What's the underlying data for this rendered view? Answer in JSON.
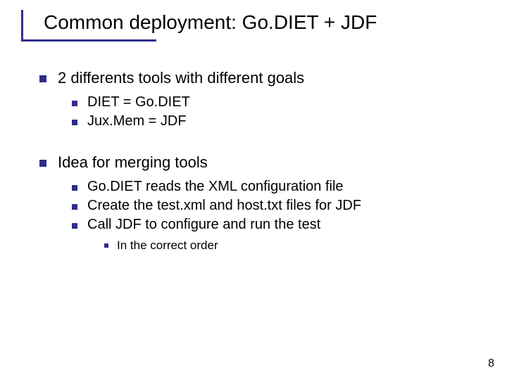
{
  "slide": {
    "title": "Common deployment: Go.DIET + JDF",
    "page_number": "8",
    "points": [
      {
        "text": "2 differents tools with different goals",
        "children": [
          {
            "text": "DIET = Go.DIET"
          },
          {
            "text": "Jux.Mem = JDF"
          }
        ]
      },
      {
        "text": "Idea for merging tools",
        "children": [
          {
            "text": "Go.DIET reads the XML configuration file"
          },
          {
            "text": "Create the test.xml and host.txt files for JDF"
          },
          {
            "text": "Call JDF to configure and run the test",
            "children": [
              {
                "text": "In the correct order"
              }
            ]
          }
        ]
      }
    ]
  }
}
